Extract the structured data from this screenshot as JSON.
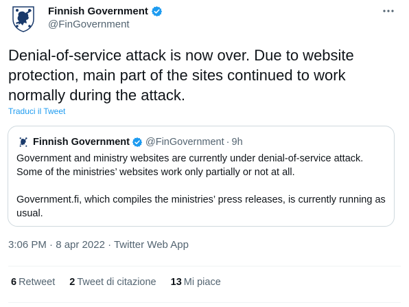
{
  "author": {
    "name": "Finnish Government",
    "handle": "@FinGovernment"
  },
  "tweet": {
    "text": "Denial-of-service attack is now over. Due to website\nprotection, main part of the sites continued to work\nnormally during the attack.",
    "translate_label": "Traduci il Tweet"
  },
  "quote": {
    "name": "Finnish Government",
    "handle": "@FinGovernment",
    "separator": "·",
    "time": "9h",
    "paragraphs": [
      "Government and ministry websites are currently under denial-of-service attack. Some of the ministries’ websites work only partially or not at all.",
      "Government.fi, which compiles the ministries’ press releases, is currently running as usual."
    ]
  },
  "meta": {
    "text": "3:06 PM · 8 apr 2022 · Twitter Web App"
  },
  "stats": [
    {
      "count": "6",
      "label": "Retweet"
    },
    {
      "count": "2",
      "label": "Tweet di citazione"
    },
    {
      "count": "13",
      "label": "Mi piace"
    }
  ],
  "colors": {
    "accent": "#1d9bf0",
    "text": "#0f1419",
    "secondary": "#536471",
    "crest": "#1a3a6b"
  },
  "icons": {
    "avatar": "finnish-coat-of-arms-icon",
    "verified": "verified-badge-icon",
    "more": "more-horizontal-icon"
  }
}
